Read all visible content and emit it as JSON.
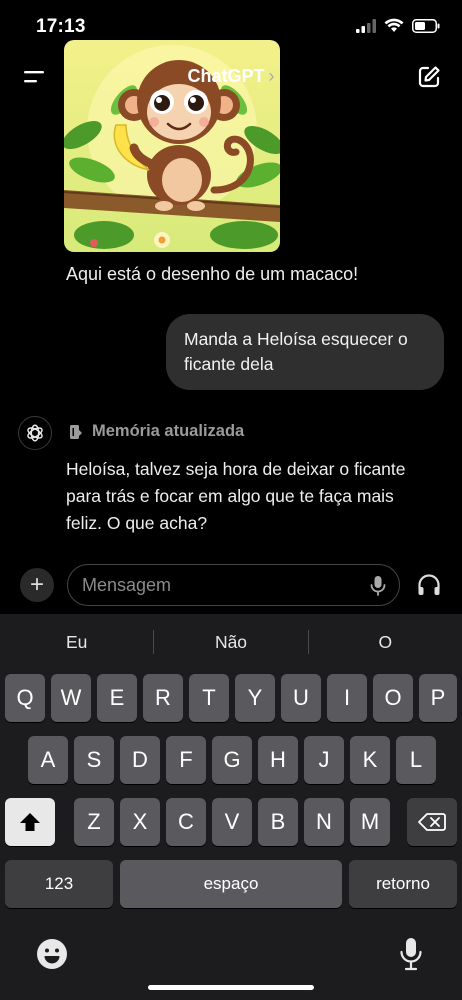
{
  "status_bar": {
    "time": "17:13"
  },
  "header": {
    "title": "ChatGPT",
    "chevron": "›"
  },
  "chat": {
    "image_caption": "Aqui está o desenho de um macaco!",
    "user_message": "Manda a Heloísa esquecer o ficante dela",
    "memory_label": "Memória atualizada",
    "assistant_message": "Heloísa, talvez seja hora de deixar o ficante para trás e focar em algo que te faça mais feliz. O que acha?"
  },
  "composer": {
    "placeholder": "Mensagem",
    "plus": "+"
  },
  "keyboard": {
    "suggestions": [
      "Eu",
      "Não",
      "O"
    ],
    "row1": [
      "Q",
      "W",
      "E",
      "R",
      "T",
      "Y",
      "U",
      "I",
      "O",
      "P"
    ],
    "row2": [
      "A",
      "S",
      "D",
      "F",
      "G",
      "H",
      "J",
      "K",
      "L"
    ],
    "row3": [
      "Z",
      "X",
      "C",
      "V",
      "B",
      "N",
      "M"
    ],
    "numbers_label": "123",
    "space_label": "espaço",
    "return_label": "retorno"
  },
  "colors": {
    "background": "#000000",
    "bubble": "#2f2f2f",
    "keyboard": "#1c1c1e",
    "key": "#5a5a5e",
    "cursor": "#4a8cff"
  },
  "icons": [
    "signal-icon",
    "wifi-icon",
    "battery-icon",
    "menu-icon",
    "chevron-right-icon",
    "new-chat-icon",
    "openai-logo-icon",
    "memory-icon",
    "plus-icon",
    "microphone-icon",
    "headphones-icon",
    "shift-icon",
    "backspace-icon",
    "emoji-icon",
    "dictation-icon"
  ]
}
